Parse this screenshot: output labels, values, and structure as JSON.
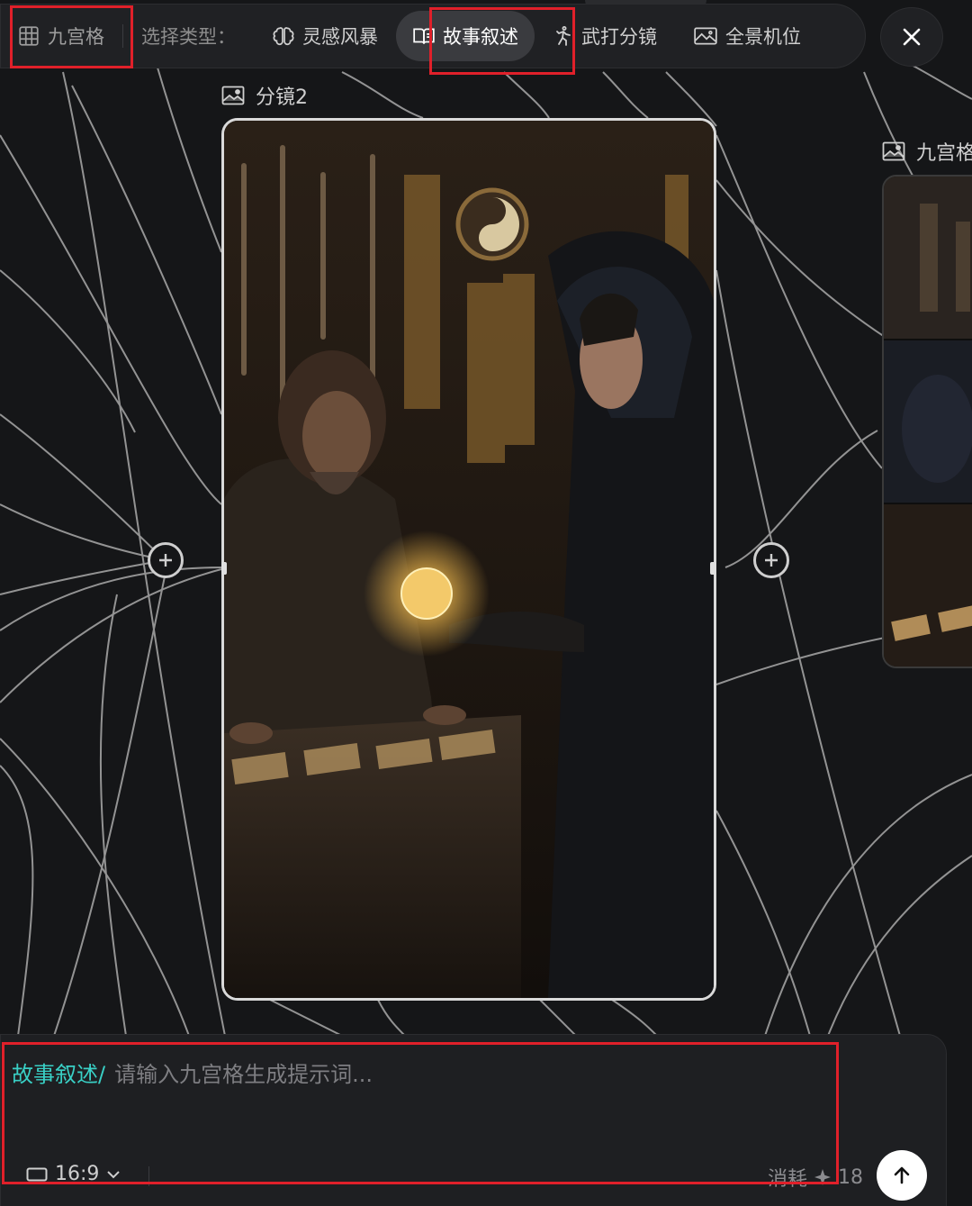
{
  "toolbar": {
    "grid_label": "九宫格",
    "select_type_label": "选择类型：",
    "tabs": [
      {
        "label": "灵感风暴",
        "icon": "brain-icon"
      },
      {
        "label": "故事叙述",
        "icon": "book-icon",
        "active": true
      },
      {
        "label": "武打分镜",
        "icon": "fighter-icon"
      },
      {
        "label": "全景机位",
        "icon": "panorama-icon"
      }
    ],
    "close_icon": "close-icon"
  },
  "frames": {
    "main_label": "分镜2",
    "side_label": "九宫格"
  },
  "prompt": {
    "type_prefix": "故事叙述/",
    "placeholder": "请输入九宫格生成提示词...",
    "aspect_ratio": "16:9",
    "cost_label": "消耗",
    "cost_value": "18",
    "send_icon": "arrow-up-icon"
  },
  "colors": {
    "background": "#151618",
    "panel": "#202124",
    "accent_teal": "#39d0c6",
    "annotation_red": "#e0202a"
  }
}
